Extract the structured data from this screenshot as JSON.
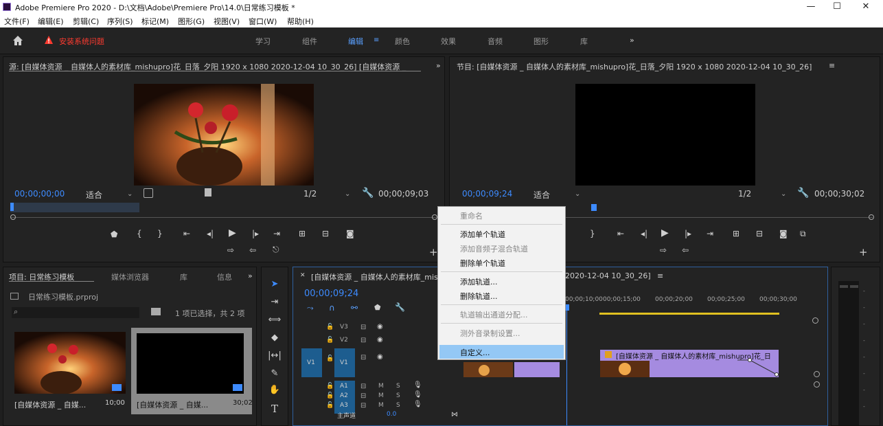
{
  "window": {
    "title": "Adobe Premiere Pro 2020 - D:\\文档\\Adobe\\Premiere Pro\\14.0\\日常练习模板 *",
    "minimize": "—",
    "maximize": "☐",
    "close": "✕"
  },
  "menubar": [
    "文件(F)",
    "编辑(E)",
    "剪辑(C)",
    "序列(S)",
    "标记(M)",
    "图形(G)",
    "视图(V)",
    "窗口(W)",
    "帮助(H)"
  ],
  "workspace": {
    "home_icon": "home-icon",
    "error_text": "安装系统问题",
    "tabs": [
      "学习",
      "组件",
      "编辑",
      "颜色",
      "效果",
      "音频",
      "图形",
      "库"
    ],
    "active_tab": "编辑",
    "more": "»"
  },
  "source": {
    "title": "源: [自媒体资源 _ 自媒体人的素材库_mishupro]花_日落_夕阳 1920 x 1080 2020-12-04 10_30_26] [自媒体资源 _",
    "timecode_in": "00;00;00;00",
    "fit": "适合",
    "scale": "1/2",
    "timecode_out": "00;00;09;03"
  },
  "program": {
    "title": "节目: [自媒体资源 _ 自媒体人的素材库_mishupro]花_日落_夕阳 1920 x 1080 2020-12-04 10_30_26]",
    "timecode": "00;00;09;24",
    "fit": "适合",
    "scale": "1/2",
    "timecode_out": "00;00;30;02"
  },
  "project": {
    "tabs": [
      "项目: 日常练习模板",
      "媒体浏览器",
      "库",
      "信息"
    ],
    "filename": "日常练习模板.prproj",
    "selection": "1 项已选择，共 2 项",
    "items": [
      {
        "name": "[自媒体资源 _ 自媒...",
        "duration": "10;00"
      },
      {
        "name": "[自媒体资源 _ 自媒...",
        "duration": "30;02"
      }
    ]
  },
  "timeline": {
    "title": "[自媒体资源 _ 自媒体人的素材库_mishupro]花_日落_夕阳 1920 x 1080 2020-12-04 10_30_26]",
    "title_tail": "2020-12-04 10_30_26]",
    "timecode": "00;00;09;24",
    "ruler": [
      "00;00;10;00",
      "00;00;15;00",
      "00;00;20;00",
      "00;00;25;00",
      "00;00;30;00"
    ],
    "tracks": {
      "v3": "V3",
      "v2": "V2",
      "v1": "V1",
      "a1": "A1",
      "a2": "A2",
      "a3": "A3",
      "master": "主声道",
      "master_value": "0.0"
    },
    "clip_label": "[自媒体资源 _ 自媒体人的素材库_mishupro]花_日"
  },
  "context_menu": {
    "items": [
      "重命名",
      "添加单个轨道",
      "添加音频子混合轨道",
      "删除单个轨道",
      "添加轨道...",
      "删除轨道...",
      "轨道输出通道分配...",
      "测外音录制设置...",
      "自定义..."
    ],
    "disabled": [
      0,
      2,
      6,
      7
    ],
    "highlighted": 8
  },
  "colors": {
    "accent_blue": "#3d8bff",
    "clip_purple": "#a58be0",
    "menu_highlight": "#94c8f5",
    "error_red": "#ff3b30",
    "track_blue": "#1d5d8f"
  }
}
